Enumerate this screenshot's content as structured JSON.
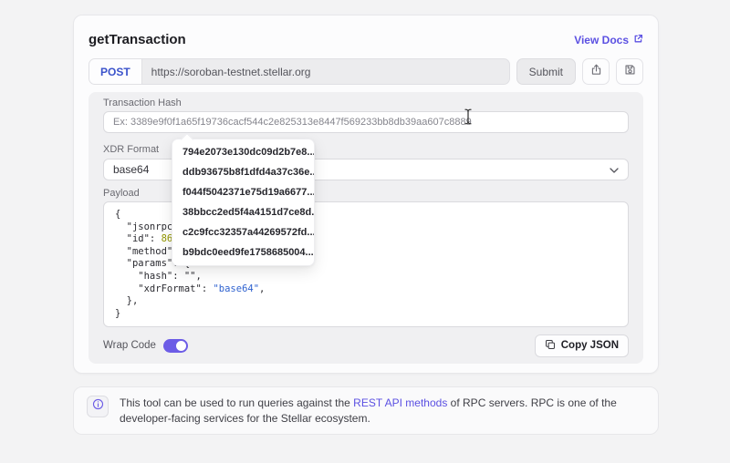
{
  "header": {
    "title": "getTransaction",
    "view_docs_label": "View Docs"
  },
  "request": {
    "method": "POST",
    "url": "https://soroban-testnet.stellar.org",
    "submit_label": "Submit"
  },
  "form": {
    "hash_label": "Transaction Hash",
    "hash_placeholder": "Ex: 3389e9f0f1a65f19736cacf544c2e825313e8447f569233bb8db39aa607c8889",
    "xdr_label": "XDR Format",
    "xdr_value": "base64",
    "payload_label": "Payload",
    "wrap_code_label": "Wrap Code",
    "wrap_code_on": true,
    "copy_json_label": "Copy JSON"
  },
  "suggestions": [
    "794e2073e130dc09d2b7e8...",
    "ddb93675b8f1dfd4a37c36e...",
    "f044f5042371e75d19a6677...",
    "38bbcc2ed5f4a4151d7ce8d...",
    "c2c9fcc32357a44269572fd...",
    "b9bdc0eed9fe1758685004..."
  ],
  "payload": {
    "lines": [
      [
        [
          "plain",
          "{"
        ]
      ],
      [
        [
          "plain",
          "  \"jsonrpc\": "
        ]
      ],
      [
        [
          "plain",
          "  \"id\": "
        ],
        [
          "num",
          "86753"
        ]
      ],
      [
        [
          "plain",
          "  \"method\": \""
        ]
      ],
      [
        [
          "plain",
          "  \"params\": {"
        ]
      ],
      [
        [
          "plain",
          "    \"hash\": \"\","
        ]
      ],
      [
        [
          "plain",
          "    \"xdrFormat\": "
        ],
        [
          "str",
          "\"base64\""
        ],
        [
          "plain",
          ","
        ]
      ],
      [
        [
          "plain",
          "  },"
        ]
      ],
      [
        [
          "plain",
          "}"
        ]
      ]
    ]
  },
  "note": {
    "text_before": "This tool can be used to run queries against the ",
    "link_label": "REST API methods",
    "text_after": " of RPC servers. RPC is one of the developer-facing services for the Stellar ecosystem."
  },
  "colors": {
    "accent_purple": "#5b50e2",
    "method_blue": "#3b53cb",
    "toggle_purple": "#6c5ce6",
    "code_number": "#939600",
    "code_string": "#2f62cf"
  }
}
